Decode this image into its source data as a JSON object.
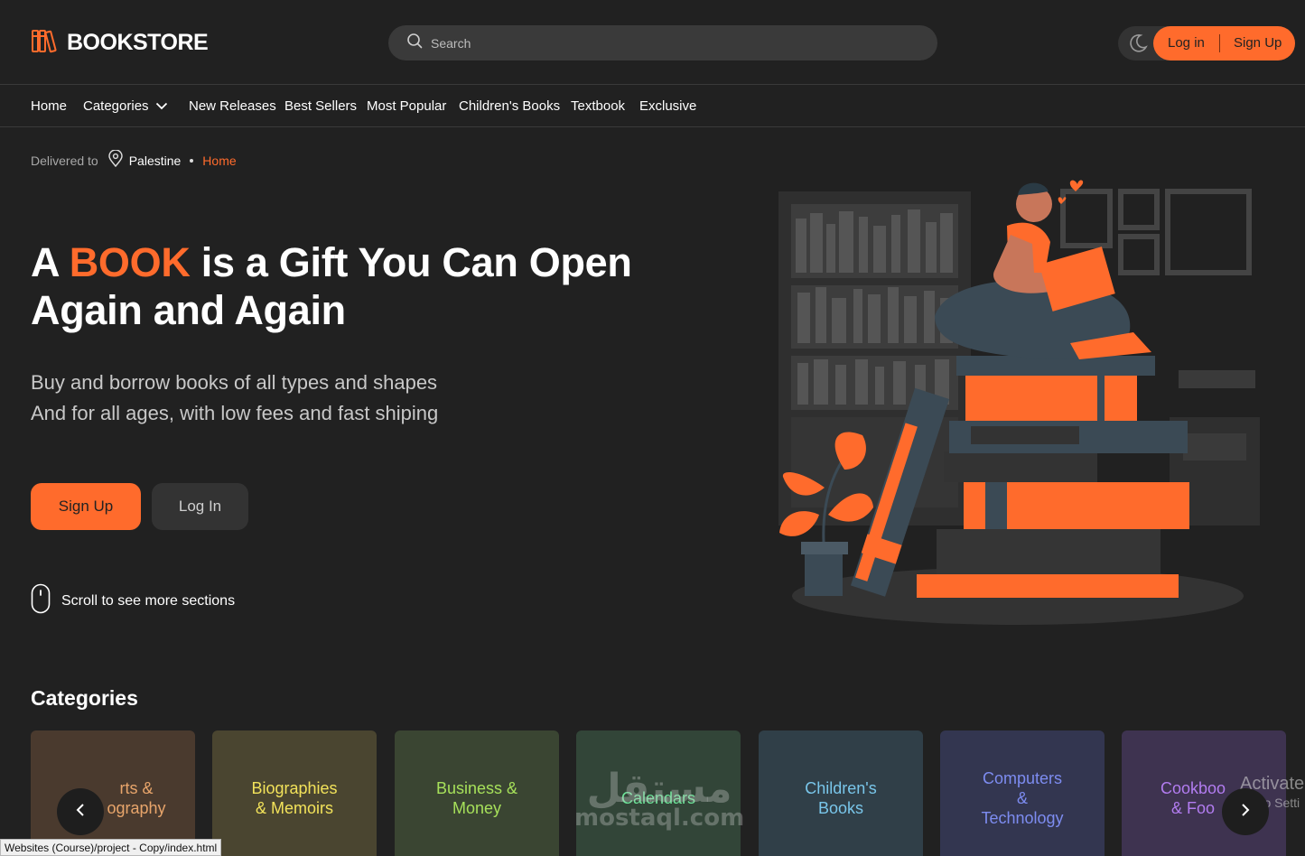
{
  "brand": {
    "name": "BOOKSTORE",
    "icon": "books-logo-icon",
    "accent": "#ff6b2c"
  },
  "search": {
    "placeholder": "Search",
    "icon": "search-icon"
  },
  "header_actions": {
    "theme_icon": "moon-icon",
    "login": "Log in",
    "signup": "Sign Up"
  },
  "nav": {
    "items": [
      {
        "label": "Home"
      },
      {
        "label": "Categories",
        "icon": "chevron-down-icon"
      },
      {
        "label": "New Releases"
      },
      {
        "label": "Best Sellers"
      },
      {
        "label": "Most Popular"
      },
      {
        "label": "Children's Books"
      },
      {
        "label": "Textbook"
      },
      {
        "label": "Exclusive"
      }
    ]
  },
  "breadcrumb": {
    "delivered_label": "Delivered to",
    "location": "Palestine",
    "current": "Home",
    "icon": "location-pin-icon"
  },
  "hero": {
    "title_prefix": "A ",
    "title_accent": "BOOK",
    "title_rest_1": " is a Gift You Can Open",
    "title_line_2": "Again and Again",
    "sub_line_1": "Buy and borrow books of all types and shapes",
    "sub_line_2": "And for all ages, with low fees and fast shiping",
    "signup_button": "Sign Up",
    "login_button": "Log In",
    "scroll_hint": "Scroll to see more sections",
    "scroll_icon": "mouse-icon",
    "illustration": "person-reading-on-books-illustration"
  },
  "categories": {
    "title": "Categories",
    "items": [
      {
        "label": "Arts & Photography",
        "display": "rts &\nography",
        "bg": "#4a3a2e",
        "fg": "#e8a56b"
      },
      {
        "label": "Biographies & Memoirs",
        "display": "Biographies\n& Memoirs",
        "bg": "#4a4530",
        "fg": "#f2e25a"
      },
      {
        "label": "Business & Money",
        "display": "Business &\nMoney",
        "bg": "#3a4532",
        "fg": "#a6e05a"
      },
      {
        "label": "Calendars",
        "display": "Calendars",
        "bg": "#324538",
        "fg": "#6ee59a"
      },
      {
        "label": "Children's Books",
        "display": "Children's\nBooks",
        "bg": "#303f48",
        "fg": "#79c6ea"
      },
      {
        "label": "Computers & Technology",
        "display": "Computers\n&\nTechnology",
        "bg": "#333650",
        "fg": "#7d8cf0"
      },
      {
        "label": "Cookbooks & Food",
        "display": "Cookboo\n& Foo",
        "bg": "#3e3350",
        "fg": "#b27cf0"
      }
    ],
    "prev_icon": "chevron-left-icon",
    "next_icon": "chevron-right-icon"
  },
  "status_bar": {
    "text": "Websites (Course)/project - Copy/index.html"
  },
  "watermark": {
    "arabic": "مستقل",
    "latin": "mostaql.com"
  },
  "os_overlay": {
    "line1": "Activate",
    "line2": "Go to Setti"
  }
}
